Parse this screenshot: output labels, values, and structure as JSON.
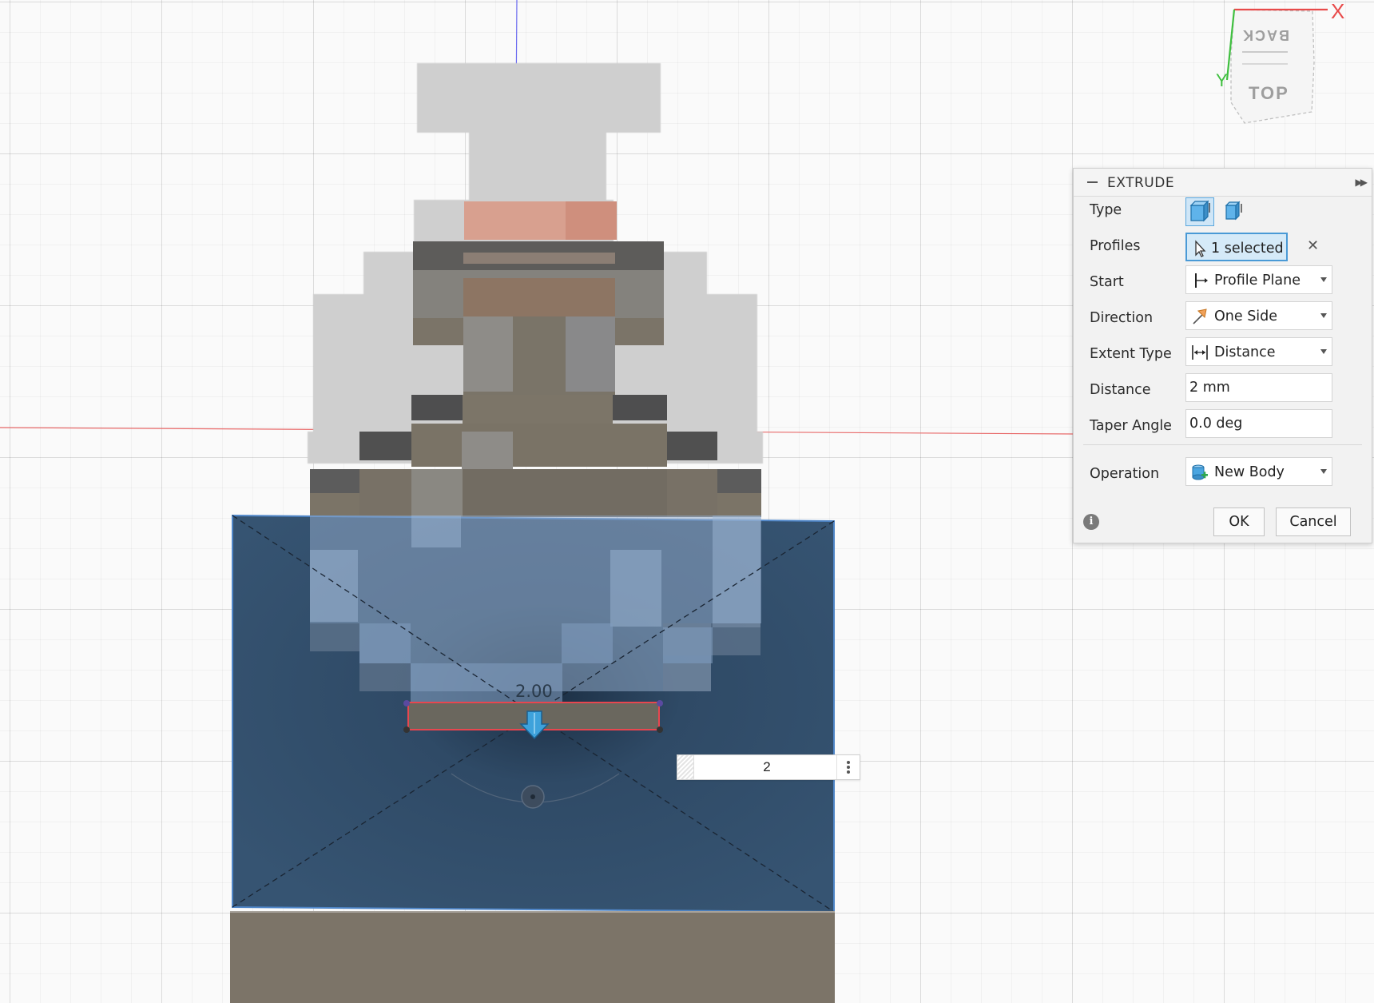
{
  "viewcube": {
    "face_top": "TOP",
    "face_back": "BACK",
    "axis_x": "X",
    "axis_y": "Y"
  },
  "canvas": {
    "dimension_label": "2.00",
    "dimension_input_value": "2"
  },
  "extrude": {
    "title": "EXTRUDE",
    "rows": {
      "type": {
        "label": "Type"
      },
      "profiles": {
        "label": "Profiles",
        "value": "1 selected",
        "icon": "cursor-select-icon"
      },
      "start": {
        "label": "Start",
        "value": "Profile Plane",
        "icon": "profile-plane-icon"
      },
      "direction": {
        "label": "Direction",
        "value": "One Side",
        "icon": "one-side-icon"
      },
      "extent_type": {
        "label": "Extent Type",
        "value": "Distance",
        "icon": "distance-icon"
      },
      "distance": {
        "label": "Distance",
        "value": "2 mm"
      },
      "taper_angle": {
        "label": "Taper Angle",
        "value": "0.0 deg"
      },
      "operation": {
        "label": "Operation",
        "value": "New Body",
        "icon": "new-body-icon"
      }
    },
    "buttons": {
      "ok": "OK",
      "cancel": "Cancel"
    }
  },
  "colors": {
    "accent": "#4a9ad6",
    "sketch_plane": "#2f4a64",
    "selected_profile_outline": "#e8464f",
    "x_axis": "#e84a4a",
    "y_axis": "#3fbf3f",
    "z_axis": "#5a5af0"
  }
}
